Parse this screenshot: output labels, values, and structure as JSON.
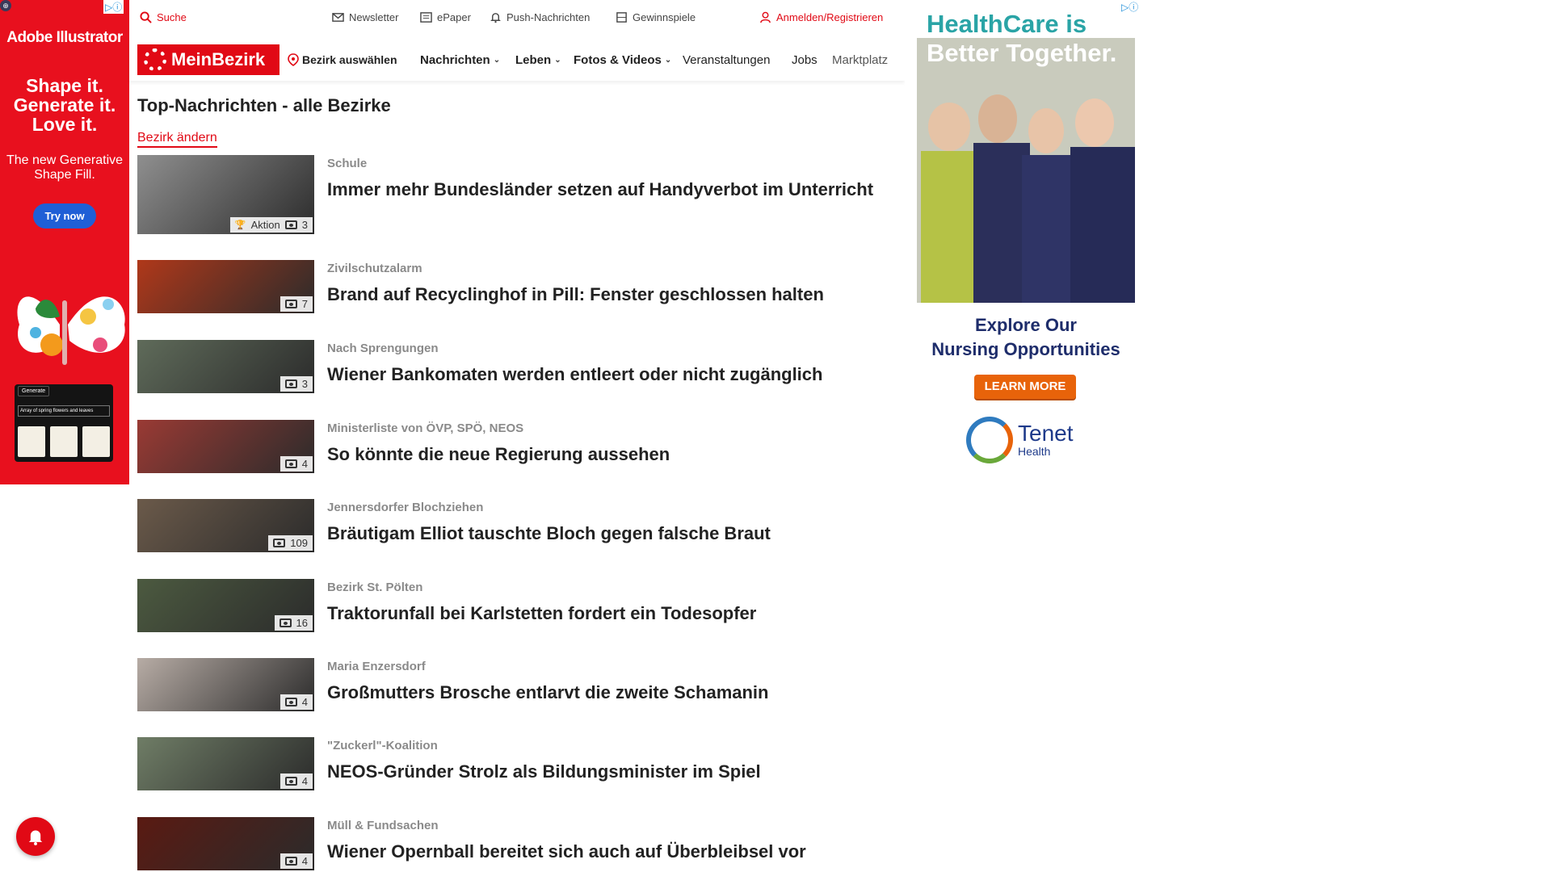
{
  "ad_left": {
    "brand": "Adobe Illustrator",
    "headline": "Shape it. Generate it. Love it.",
    "subline": "The new Generative Shape Fill.",
    "cta": "Try now",
    "generate_label": "Generate",
    "prompt_text": "Array of spring flowers and leaves",
    "adchoice": "▷ⓘ"
  },
  "utility_bar": {
    "search": "Suche",
    "newsletter": "Newsletter",
    "epaper": "ePaper",
    "push": "Push-Nachrichten",
    "gewinnspiele": "Gewinnspiele",
    "login": "Anmelden/Registrieren"
  },
  "nav": {
    "logo": "MeinBezirk",
    "bezirk": "Bezirk auswählen",
    "items": [
      "Nachrichten",
      "Leben",
      "Fotos & Videos",
      "Veranstaltungen",
      "Jobs",
      "Marktplatz"
    ]
  },
  "content": {
    "title": "Top-Nachrichten - alle Bezirke",
    "change_bezirk": "Bezirk ändern",
    "articles": [
      {
        "kicker": "Schule",
        "headline": "Immer mehr Bundesländer setzen auf Handyverbot im Unterricht",
        "count": "3",
        "extra": "Aktion",
        "thumb_color": "#8f8f8f"
      },
      {
        "kicker": "Zivilschutzalarm",
        "headline": "Brand auf Recyclinghof in Pill: Fenster geschlossen halten",
        "count": "7",
        "thumb_color": "#b0381a"
      },
      {
        "kicker": "Nach Sprengungen",
        "headline": "Wiener Bankomaten werden entleert oder nicht zugänglich",
        "count": "3",
        "thumb_color": "#5f6b5a"
      },
      {
        "kicker": "Ministerliste von ÖVP, SPÖ, NEOS",
        "headline": "So könnte die neue Regierung aussehen",
        "count": "4",
        "thumb_color": "#9a3a34"
      },
      {
        "kicker": "Jennersdorfer Blochziehen",
        "headline": "Bräutigam Elliot tauschte Bloch gegen falsche Braut",
        "count": "109",
        "thumb_color": "#6b5a4a"
      },
      {
        "kicker": "Bezirk St. Pölten",
        "headline": "Traktorunfall bei Karlstetten fordert ein Todesopfer",
        "count": "16",
        "thumb_color": "#4c5a40"
      },
      {
        "kicker": "Maria Enzersdorf",
        "headline": "Großmutters Brosche entlarvt die zweite Schamanin",
        "count": "4",
        "thumb_color": "#b7aca5"
      },
      {
        "kicker": "\"Zuckerl\"-Koalition",
        "headline": "NEOS-Gründer Strolz als Bildungsminister im Spiel",
        "count": "4",
        "thumb_color": "#6f7d66"
      },
      {
        "kicker": "Müll & Fundsachen",
        "headline": "Wiener Opernball bereitet sich auch auf Überbleibsel vor",
        "count": "4",
        "thumb_color": "#5a1a12"
      }
    ]
  },
  "ad_right": {
    "headline_1": "HealthCare is",
    "headline_2": "Better Together.",
    "explore_1": "Explore Our",
    "explore_2": "Nursing Opportunities",
    "cta": "LEARN MORE",
    "brand": "Tenet",
    "brand_sub": "Health",
    "adchoice": "▷ⓘ"
  }
}
